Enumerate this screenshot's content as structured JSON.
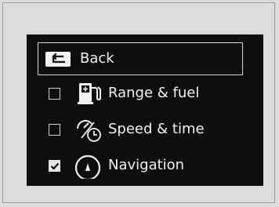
{
  "menu": {
    "back_label": "Back",
    "items": [
      {
        "label": "Range & fuel",
        "checked": false,
        "icon": "fuel-pump-icon"
      },
      {
        "label": "Speed & time",
        "checked": false,
        "icon": "speed-time-icon"
      },
      {
        "label": "Navigation",
        "checked": true,
        "icon": "navigation-compass-icon"
      }
    ]
  },
  "colors": {
    "screen_background": "#0e0e0e",
    "text": "#f2f2f2",
    "page_background": "#dcdcdc"
  }
}
